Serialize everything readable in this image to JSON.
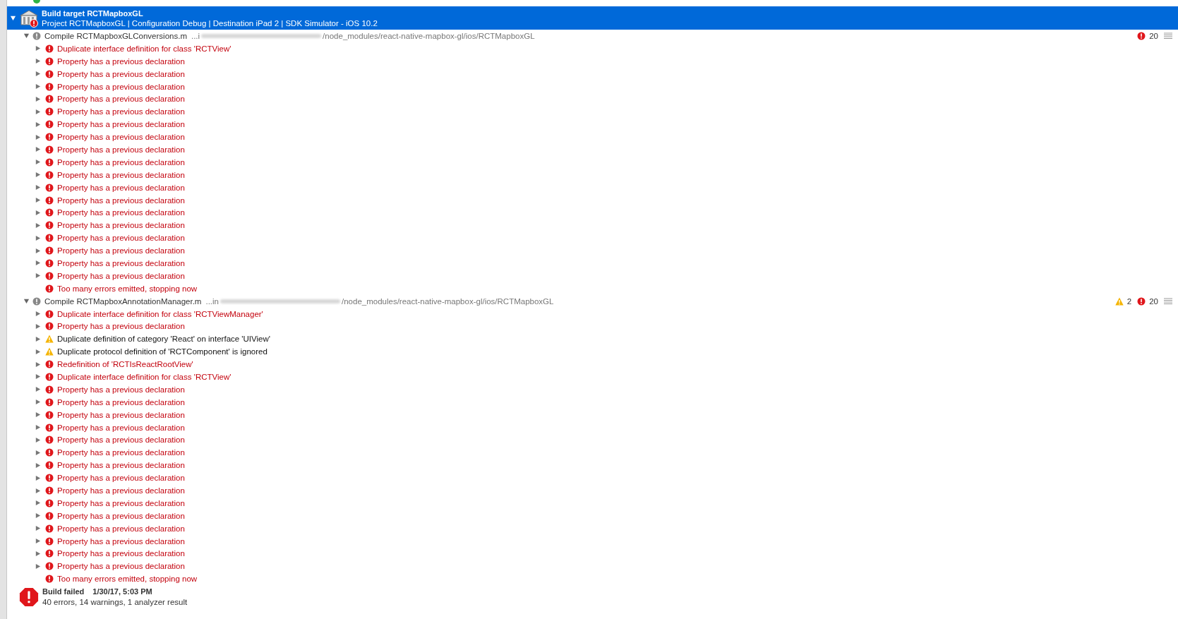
{
  "build_target": {
    "title": "Build target RCTMapboxGL",
    "subtitle": "Project RCTMapboxGL | Configuration Debug | Destination iPad 2 | SDK Simulator - iOS 10.2",
    "expanded": true,
    "selected": true
  },
  "groups": [
    {
      "file": "Compile RCTMapboxGLConversions.m",
      "path_prefix": "...i",
      "path": "/node_modules/react-native-mapbox-gl/ios/RCTMapboxGL",
      "expanded": true,
      "errors": "20",
      "items": [
        {
          "kind": "error",
          "text": "Duplicate interface definition for class 'RCTView'",
          "expanded": false
        },
        {
          "kind": "error",
          "text": "Property has a previous declaration",
          "expanded": false
        },
        {
          "kind": "error",
          "text": "Property has a previous declaration",
          "expanded": false
        },
        {
          "kind": "error",
          "text": "Property has a previous declaration",
          "expanded": false
        },
        {
          "kind": "error",
          "text": "Property has a previous declaration",
          "expanded": false
        },
        {
          "kind": "error",
          "text": "Property has a previous declaration",
          "expanded": false
        },
        {
          "kind": "error",
          "text": "Property has a previous declaration",
          "expanded": false
        },
        {
          "kind": "error",
          "text": "Property has a previous declaration",
          "expanded": false
        },
        {
          "kind": "error",
          "text": "Property has a previous declaration",
          "expanded": false
        },
        {
          "kind": "error",
          "text": "Property has a previous declaration",
          "expanded": false
        },
        {
          "kind": "error",
          "text": "Property has a previous declaration",
          "expanded": false
        },
        {
          "kind": "error",
          "text": "Property has a previous declaration",
          "expanded": false
        },
        {
          "kind": "error",
          "text": "Property has a previous declaration",
          "expanded": false
        },
        {
          "kind": "error",
          "text": "Property has a previous declaration",
          "expanded": false
        },
        {
          "kind": "error",
          "text": "Property has a previous declaration",
          "expanded": false
        },
        {
          "kind": "error",
          "text": "Property has a previous declaration",
          "expanded": false
        },
        {
          "kind": "error",
          "text": "Property has a previous declaration",
          "expanded": false
        },
        {
          "kind": "error",
          "text": "Property has a previous declaration",
          "expanded": false
        },
        {
          "kind": "error",
          "text": "Property has a previous declaration",
          "expanded": false
        },
        {
          "kind": "error",
          "text": "Too many errors emitted, stopping now"
        }
      ]
    },
    {
      "file": "Compile RCTMapboxAnnotationManager.m",
      "path_prefix": "...in",
      "path": "/node_modules/react-native-mapbox-gl/ios/RCTMapboxGL",
      "expanded": true,
      "warnings": "2",
      "errors": "20",
      "items": [
        {
          "kind": "error",
          "text": "Duplicate interface definition for class 'RCTViewManager'",
          "expanded": false
        },
        {
          "kind": "error",
          "text": "Property has a previous declaration",
          "expanded": false
        },
        {
          "kind": "warning",
          "text": "Duplicate definition of category 'React' on interface 'UIView'",
          "expanded": false
        },
        {
          "kind": "warning",
          "text": "Duplicate protocol definition of 'RCTComponent' is ignored",
          "expanded": false
        },
        {
          "kind": "error",
          "text": "Redefinition of 'RCTIsReactRootView'",
          "expanded": false
        },
        {
          "kind": "error",
          "text": "Duplicate interface definition for class 'RCTView'",
          "expanded": false
        },
        {
          "kind": "error",
          "text": "Property has a previous declaration",
          "expanded": false
        },
        {
          "kind": "error",
          "text": "Property has a previous declaration",
          "expanded": false
        },
        {
          "kind": "error",
          "text": "Property has a previous declaration",
          "expanded": false
        },
        {
          "kind": "error",
          "text": "Property has a previous declaration",
          "expanded": false
        },
        {
          "kind": "error",
          "text": "Property has a previous declaration",
          "expanded": false
        },
        {
          "kind": "error",
          "text": "Property has a previous declaration",
          "expanded": false
        },
        {
          "kind": "error",
          "text": "Property has a previous declaration",
          "expanded": false
        },
        {
          "kind": "error",
          "text": "Property has a previous declaration",
          "expanded": false
        },
        {
          "kind": "error",
          "text": "Property has a previous declaration",
          "expanded": false
        },
        {
          "kind": "error",
          "text": "Property has a previous declaration",
          "expanded": false
        },
        {
          "kind": "error",
          "text": "Property has a previous declaration",
          "expanded": false
        },
        {
          "kind": "error",
          "text": "Property has a previous declaration",
          "expanded": false
        },
        {
          "kind": "error",
          "text": "Property has a previous declaration",
          "expanded": false
        },
        {
          "kind": "error",
          "text": "Property has a previous declaration",
          "expanded": false
        },
        {
          "kind": "error",
          "text": "Property has a previous declaration",
          "expanded": false
        },
        {
          "kind": "error",
          "text": "Too many errors emitted, stopping now"
        }
      ]
    }
  ],
  "summary": {
    "status": "Build failed",
    "time": "1/30/17, 5:03 PM",
    "details": "40 errors, 14 warnings, 1 analyzer result"
  }
}
